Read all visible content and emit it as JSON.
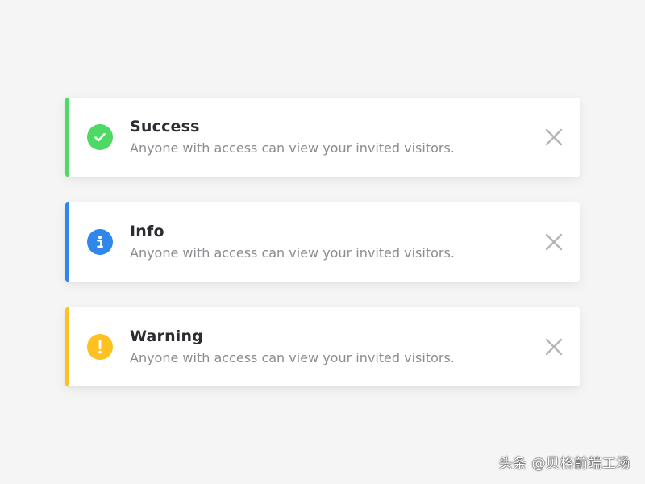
{
  "notifications": [
    {
      "type": "success",
      "title": "Success",
      "message": "Anyone with access can view your invited visitors.",
      "accent_color": "#4cd964",
      "icon": "check-circle-icon"
    },
    {
      "type": "info",
      "title": "Info",
      "message": "Anyone with access can view your invited visitors.",
      "accent_color": "#2f86eb",
      "icon": "info-circle-icon"
    },
    {
      "type": "warning",
      "title": "Warning",
      "message": "Anyone with access can view your invited visitors.",
      "accent_color": "#ffc021",
      "icon": "exclamation-circle-icon"
    }
  ],
  "close_icon": "close-icon",
  "watermark": {
    "text": "头条 @贝格前端工场"
  }
}
